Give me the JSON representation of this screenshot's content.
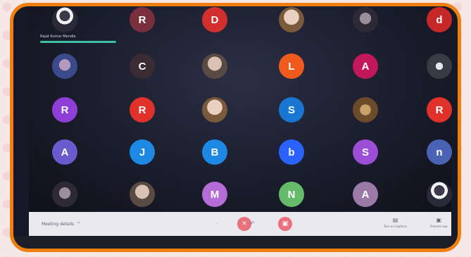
{
  "tile_label": "Rajat Kumar Mandle",
  "bottom": {
    "meeting_details": "Meeting details",
    "meeting_caret": "^",
    "more_dot": "·",
    "hand_icon": "↶",
    "side1_label": "Turn on captions",
    "side2_label": "Present now"
  },
  "participants": [
    {
      "kind": "photo",
      "style": "person",
      "letter": ""
    },
    {
      "kind": "letter",
      "letter": "R",
      "color": "#7a2f3c"
    },
    {
      "kind": "letter",
      "letter": "D",
      "color": "#d32f2f"
    },
    {
      "kind": "photo",
      "style": "warm",
      "letter": ""
    },
    {
      "kind": "photo",
      "style": "dark",
      "letter": ""
    },
    {
      "kind": "letter",
      "letter": "d",
      "color": "#c62828"
    },
    {
      "kind": "photo",
      "style": "blue",
      "letter": ""
    },
    {
      "kind": "letter",
      "letter": "C",
      "color": "#3b2b33"
    },
    {
      "kind": "photo",
      "style": "",
      "letter": ""
    },
    {
      "kind": "letter",
      "letter": "L",
      "color": "#f05a1d"
    },
    {
      "kind": "letter",
      "letter": "A",
      "color": "#c2185b"
    },
    {
      "kind": "photo",
      "style": "spider",
      "letter": ""
    },
    {
      "kind": "letter",
      "letter": "R",
      "color": "#8e3fd8"
    },
    {
      "kind": "letter",
      "letter": "R",
      "color": "#e0312b"
    },
    {
      "kind": "photo",
      "style": "warm",
      "letter": ""
    },
    {
      "kind": "letter",
      "letter": "S",
      "color": "#1976d2"
    },
    {
      "kind": "photo",
      "style": "tiger",
      "letter": ""
    },
    {
      "kind": "letter",
      "letter": "R",
      "color": "#e0312b"
    },
    {
      "kind": "letter",
      "letter": "A",
      "color": "#6a5acd"
    },
    {
      "kind": "letter",
      "letter": "J",
      "color": "#1e88e5"
    },
    {
      "kind": "letter",
      "letter": "B",
      "color": "#1e88e5"
    },
    {
      "kind": "letter",
      "letter": "b",
      "color": "#2962ff"
    },
    {
      "kind": "letter",
      "letter": "S",
      "color": "#9c4fd6"
    },
    {
      "kind": "letter",
      "letter": "n",
      "color": "#4a63b5"
    },
    {
      "kind": "photo",
      "style": "dark",
      "letter": ""
    },
    {
      "kind": "photo",
      "style": "",
      "letter": ""
    },
    {
      "kind": "letter",
      "letter": "M",
      "color": "#b56cd6"
    },
    {
      "kind": "letter",
      "letter": "N",
      "color": "#66bb6a"
    },
    {
      "kind": "letter",
      "letter": "A",
      "color": "#9c7aa8"
    },
    {
      "kind": "photo",
      "style": "person",
      "letter": ""
    }
  ]
}
